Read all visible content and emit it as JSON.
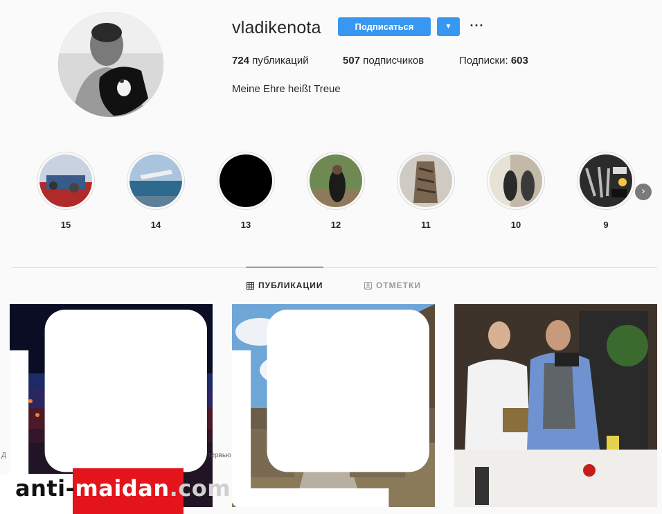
{
  "profile": {
    "username": "vladikenota",
    "follow_label": "Подписаться",
    "dropdown_glyph": "▼",
    "more_glyph": "···",
    "bio": "Meine Ehre heißt Treue",
    "stats": {
      "posts_count": "724",
      "posts_label": "публикаций",
      "followers_count": "507",
      "followers_label": "подписчиков",
      "following_label": "Подписки:",
      "following_count": "603"
    }
  },
  "highlights": [
    {
      "label": "15"
    },
    {
      "label": "14"
    },
    {
      "label": "13"
    },
    {
      "label": "12"
    },
    {
      "label": "11"
    },
    {
      "label": "10"
    },
    {
      "label": "9"
    }
  ],
  "highlights_next_glyph": "›",
  "tabs": [
    {
      "label": "ПУБЛИКАЦИИ",
      "icon": "grid-icon",
      "active": true
    },
    {
      "label": "ОТМЕТКИ",
      "icon": "tagged-icon",
      "active": false
    }
  ],
  "watermark": {
    "caption_left": "Д",
    "caption_right": "тервью",
    "part1": "anti-",
    "part2": "maidan",
    "part3": ".com"
  },
  "colors": {
    "accent": "#3897f0",
    "watermark_red": "#e3141b"
  }
}
